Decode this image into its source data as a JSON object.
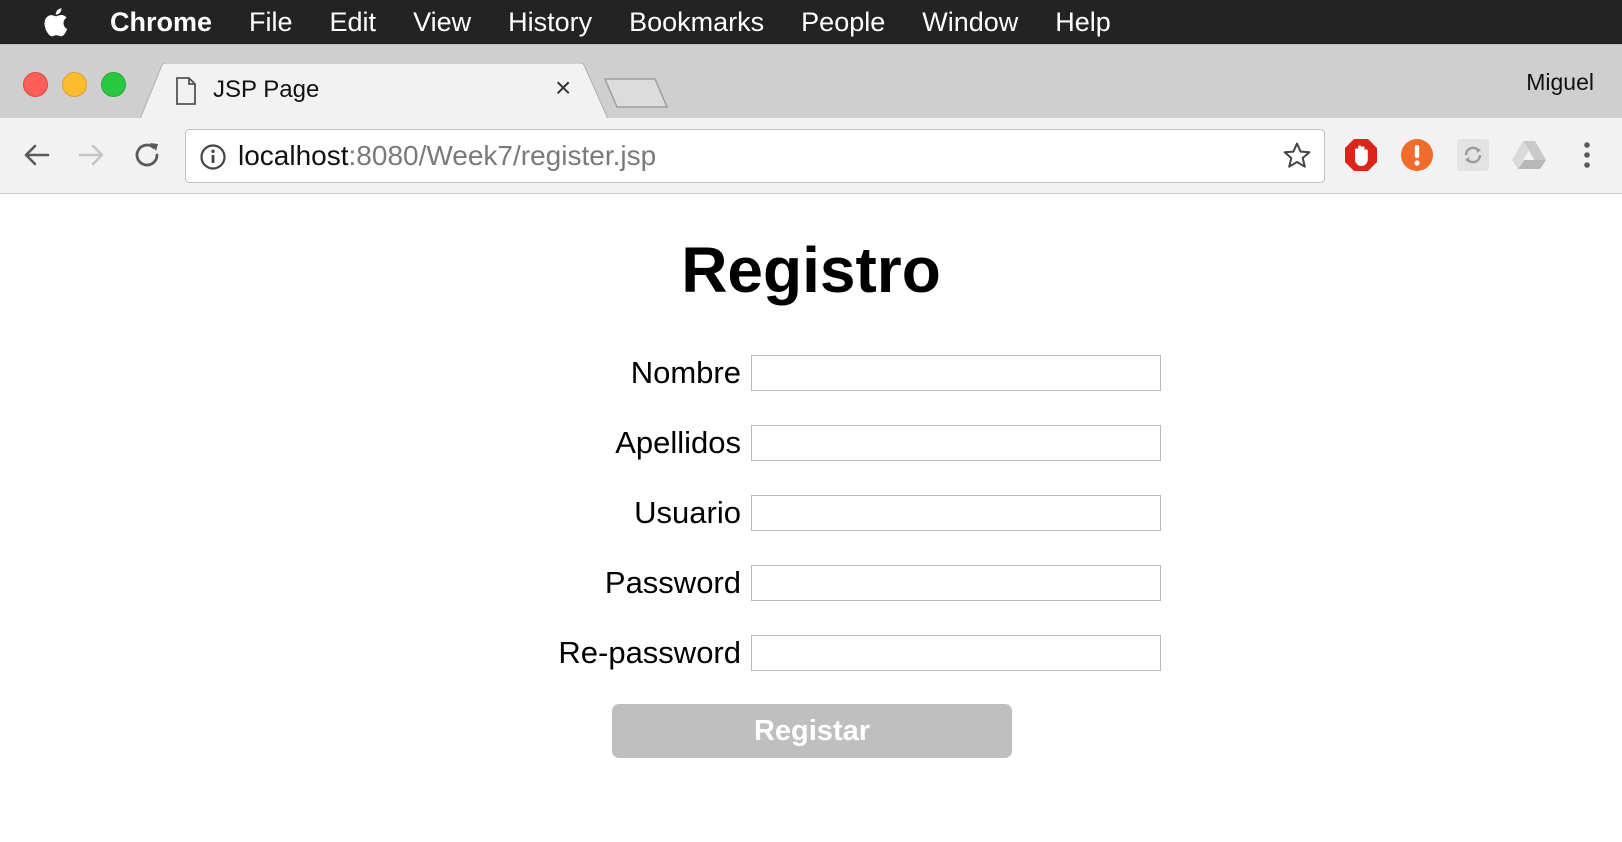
{
  "menubar": {
    "apple_icon": "apple-logo-icon",
    "items": [
      "Chrome",
      "File",
      "Edit",
      "View",
      "History",
      "Bookmarks",
      "People",
      "Window",
      "Help"
    ]
  },
  "browser": {
    "tab": {
      "title": "JSP Page",
      "icon": "document-icon",
      "close_glyph": "×"
    },
    "profile_name": "Miguel",
    "address_bar": {
      "host": "localhost",
      "path": ":8080/Week7/register.jsp"
    },
    "extensions": [
      "adblock-hand-icon",
      "alert-circle-icon",
      "sync-icon",
      "drive-icon"
    ]
  },
  "page": {
    "title": "Registro",
    "fields": [
      {
        "label": "Nombre",
        "value": ""
      },
      {
        "label": "Apellidos",
        "value": ""
      },
      {
        "label": "Usuario",
        "value": ""
      },
      {
        "label": "Password",
        "value": ""
      },
      {
        "label": "Re-password",
        "value": ""
      }
    ],
    "submit_label": "Registar"
  },
  "colors": {
    "menubar_bg": "#232323",
    "submit_bg": "#bfbfbf",
    "alert_orange": "#ef6c2b",
    "adblock_red": "#d8261b"
  }
}
